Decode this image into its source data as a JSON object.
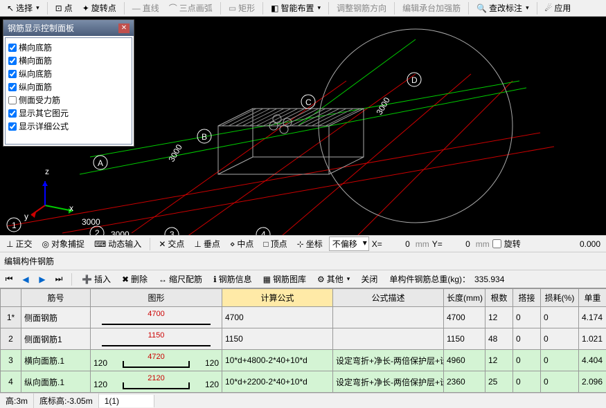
{
  "top_toolbar": {
    "select": "选择",
    "point": "点",
    "rotate_point": "旋转点",
    "line": "直线",
    "arc3": "三点画弧",
    "rect": "矩形",
    "smart_layout": "智能布置",
    "adjust_rebar_dir": "调整钢筋方向",
    "edit_cap_rebar": "编辑承台加强筋",
    "check_annot": "查改标注",
    "apply": "应用"
  },
  "float_panel": {
    "title": "钢筋显示控制面板",
    "items": [
      {
        "label": "横向底筋",
        "checked": true
      },
      {
        "label": "横向面筋",
        "checked": true
      },
      {
        "label": "纵向底筋",
        "checked": true
      },
      {
        "label": "纵向面筋",
        "checked": true
      },
      {
        "label": "侧面受力筋",
        "checked": false
      },
      {
        "label": "显示其它图元",
        "checked": true
      },
      {
        "label": "显示详细公式",
        "checked": true
      }
    ]
  },
  "viewport": {
    "labels": {
      "A": "A",
      "B": "B",
      "C": "C",
      "D": "D",
      "n1": "1",
      "n2": "2",
      "n3": "3",
      "n4": "4"
    },
    "dims": {
      "d1": "3000",
      "d2": "3000",
      "d3": "3000",
      "d4": "3000"
    },
    "axes": {
      "x": "x",
      "y": "y",
      "z": "z"
    }
  },
  "mid_toolbar": {
    "ortho": "正交",
    "osnap": "对象捕捉",
    "dyninput": "动态输入",
    "intersect": "交点",
    "perp": "垂点",
    "midpoint": "中点",
    "vertex": "顶点",
    "coord": "坐标",
    "no_offset": "不偏移",
    "x_label": "X=",
    "x_val": "0",
    "x_unit": "mm",
    "y_label": "Y=",
    "y_val": "0",
    "y_unit": "mm",
    "rotate": "旋转",
    "rotate_val": "0.000"
  },
  "section_title": "编辑构件钢筋",
  "nav_toolbar": {
    "insert": "插入",
    "delete": "删除",
    "scale_rebar": "缩尺配筋",
    "rebar_info": "钢筋信息",
    "rebar_lib": "钢筋图库",
    "other": "其他",
    "close": "关闭",
    "total_label": "单构件钢筋总重(kg)：",
    "total_val": "335.934"
  },
  "table": {
    "headers": [
      "",
      "筋号",
      "图形",
      "计算公式",
      "公式描述",
      "长度(mm)",
      "根数",
      "搭接",
      "损耗(%)",
      "单重"
    ],
    "rows": [
      {
        "n": "1*",
        "id": "侧面钢筋",
        "shape": "4700",
        "formula": "4700",
        "desc": "",
        "len": "4700",
        "count": "12",
        "lap": "0",
        "loss": "0",
        "wt": "4.174",
        "green": false,
        "shape_type": "line"
      },
      {
        "n": "2",
        "id": "侧面钢筋1",
        "shape": "1150",
        "formula": "1150",
        "desc": "",
        "len": "1150",
        "count": "48",
        "lap": "0",
        "loss": "0",
        "wt": "1.021",
        "green": false,
        "shape_type": "line"
      },
      {
        "n": "3",
        "id": "横向面筋.1",
        "shape": "4720",
        "shape_l": "120",
        "shape_r": "120",
        "formula": "10*d+4800-2*40+10*d",
        "desc": "设定弯折+净长-两倍保护层+设定弯折",
        "len": "4960",
        "count": "12",
        "lap": "0",
        "loss": "0",
        "wt": "4.404",
        "green": true,
        "shape_type": "u"
      },
      {
        "n": "4",
        "id": "纵向面筋.1",
        "shape": "2120",
        "shape_l": "120",
        "shape_r": "120",
        "formula": "10*d+2200-2*40+10*d",
        "desc": "设定弯折+净长-两倍保护层+设定弯折",
        "len": "2360",
        "count": "25",
        "lap": "0",
        "loss": "0",
        "wt": "2.096",
        "green": true,
        "shape_type": "u"
      }
    ]
  },
  "statusbar": {
    "height": "高:3m",
    "base_elev": "底标高:-3.05m",
    "pos": "1(1)"
  }
}
